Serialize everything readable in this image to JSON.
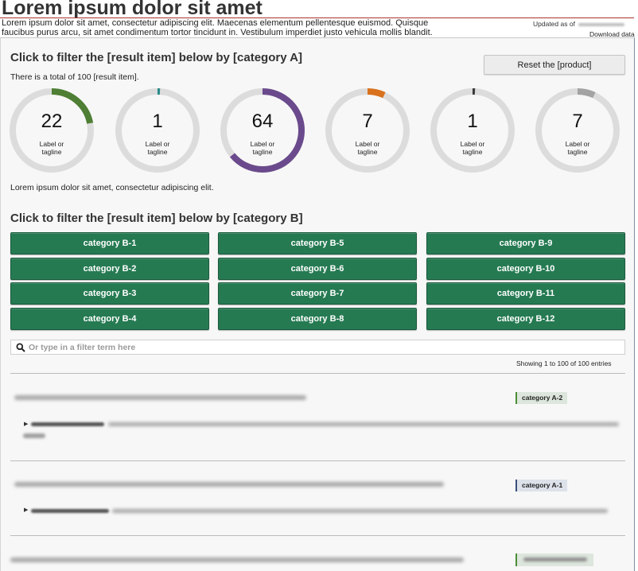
{
  "header": {
    "title": "Lorem ipsum dolor sit amet",
    "intro": "Lorem ipsum dolor sit amet, consectetur adipiscing elit. Maecenas elementum pellentesque euismod. Quisque faucibus purus arcu, sit amet condimentum tortor tincidunt in. Vestibulum imperdiet justo vehicula mollis blandit.",
    "updated_label": "Updated as of",
    "download_label": "Download data"
  },
  "filter_a": {
    "heading": "Click to filter the [result item] below by [category A]",
    "total_text": "There is a total of 100 [result item].",
    "reset_label": "Reset the [product]",
    "track_color": "#dcdcdc",
    "donuts": [
      {
        "value": "22",
        "label": "Label or tagline",
        "fraction": 0.22,
        "color": "#4e7f34"
      },
      {
        "value": "1",
        "label": "Label or tagline",
        "fraction": 0.01,
        "color": "#2a8a8a"
      },
      {
        "value": "64",
        "label": "Label or tagline",
        "fraction": 0.64,
        "color": "#6a4a8c"
      },
      {
        "value": "7",
        "label": "Label or tagline",
        "fraction": 0.07,
        "color": "#d9711d"
      },
      {
        "value": "1",
        "label": "Label or tagline",
        "fraction": 0.01,
        "color": "#3a3a3a"
      },
      {
        "value": "7",
        "label": "Label or tagline",
        "fraction": 0.07,
        "color": "#a3a3a3"
      }
    ],
    "after_text": "Lorem ipsum dolor sit amet, consectetur adipiscing elit."
  },
  "filter_b": {
    "heading": "Click to filter the [result item] below by [category B]",
    "button_color": "#257a52",
    "buttons": [
      "category B-1",
      "category B-2",
      "category B-3",
      "category B-4",
      "category B-5",
      "category B-6",
      "category B-7",
      "category B-8",
      "category B-9",
      "category B-10",
      "category B-11",
      "category B-12"
    ]
  },
  "search": {
    "placeholder": "Or type in a filter term here",
    "value": ""
  },
  "results": {
    "showing_text": "Showing 1 to 100 of 100 entries",
    "items": [
      {
        "category": "category A-2"
      },
      {
        "category": "category A-1"
      }
    ]
  }
}
